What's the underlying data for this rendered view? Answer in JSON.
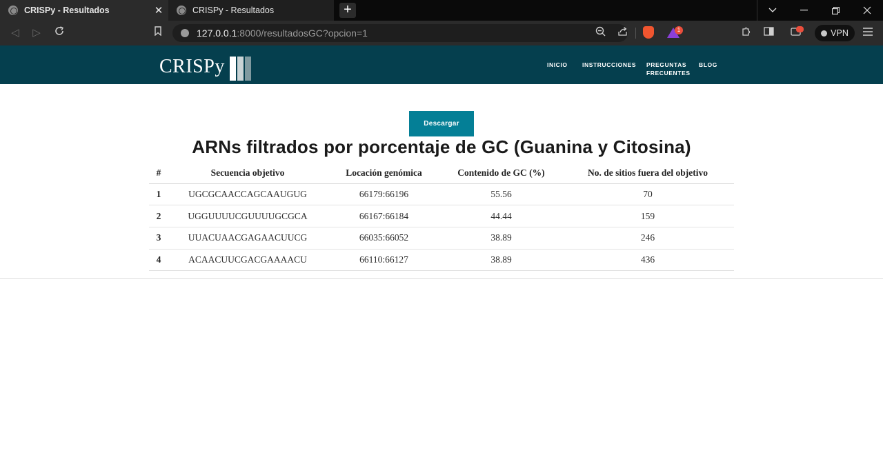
{
  "browser": {
    "tabs": [
      {
        "title": "CRISPy - Resultados",
        "active": true
      },
      {
        "title": "CRISPy - Resultados",
        "active": false
      }
    ],
    "url_host": "127.0.0.1",
    "url_rest": ":8000/resultadosGC?opcion=1",
    "rewards_badge": "1",
    "vpn_label": "VPN",
    "accent_colors": {
      "shield": "#f0552f",
      "rewards": "#8b3fd8",
      "badge": "#ea4e3c"
    }
  },
  "site": {
    "logo": "CRISPy",
    "header_color": "#053f4e",
    "nav": [
      {
        "label": "INICIO"
      },
      {
        "label": "INSTRUCCIONES"
      },
      {
        "label_line1": "PREGUNTAS",
        "label_line2": "FRECUENTES"
      },
      {
        "label": "BLOG"
      }
    ]
  },
  "main": {
    "download_button": "Descargar",
    "download_color": "#047f96",
    "title": "ARNs filtrados por porcentaje de GC (Guanina y Citosina)",
    "table": {
      "headers": [
        "#",
        "Secuencia objetivo",
        "Locación genómica",
        "Contenido de GC (%)",
        "No. de sitios fuera del objetivo"
      ],
      "rows": [
        [
          "1",
          "UGCGCAACCAGCAAUGUG",
          "66179:66196",
          "55.56",
          "70"
        ],
        [
          "2",
          "UGGUUUUCGUUUUGCGCA",
          "66167:66184",
          "44.44",
          "159"
        ],
        [
          "3",
          "UUACUAACGAGAACUUCG",
          "66035:66052",
          "38.89",
          "246"
        ],
        [
          "4",
          "ACAACUUCGACGAAAACU",
          "66110:66127",
          "38.89",
          "436"
        ]
      ]
    }
  }
}
